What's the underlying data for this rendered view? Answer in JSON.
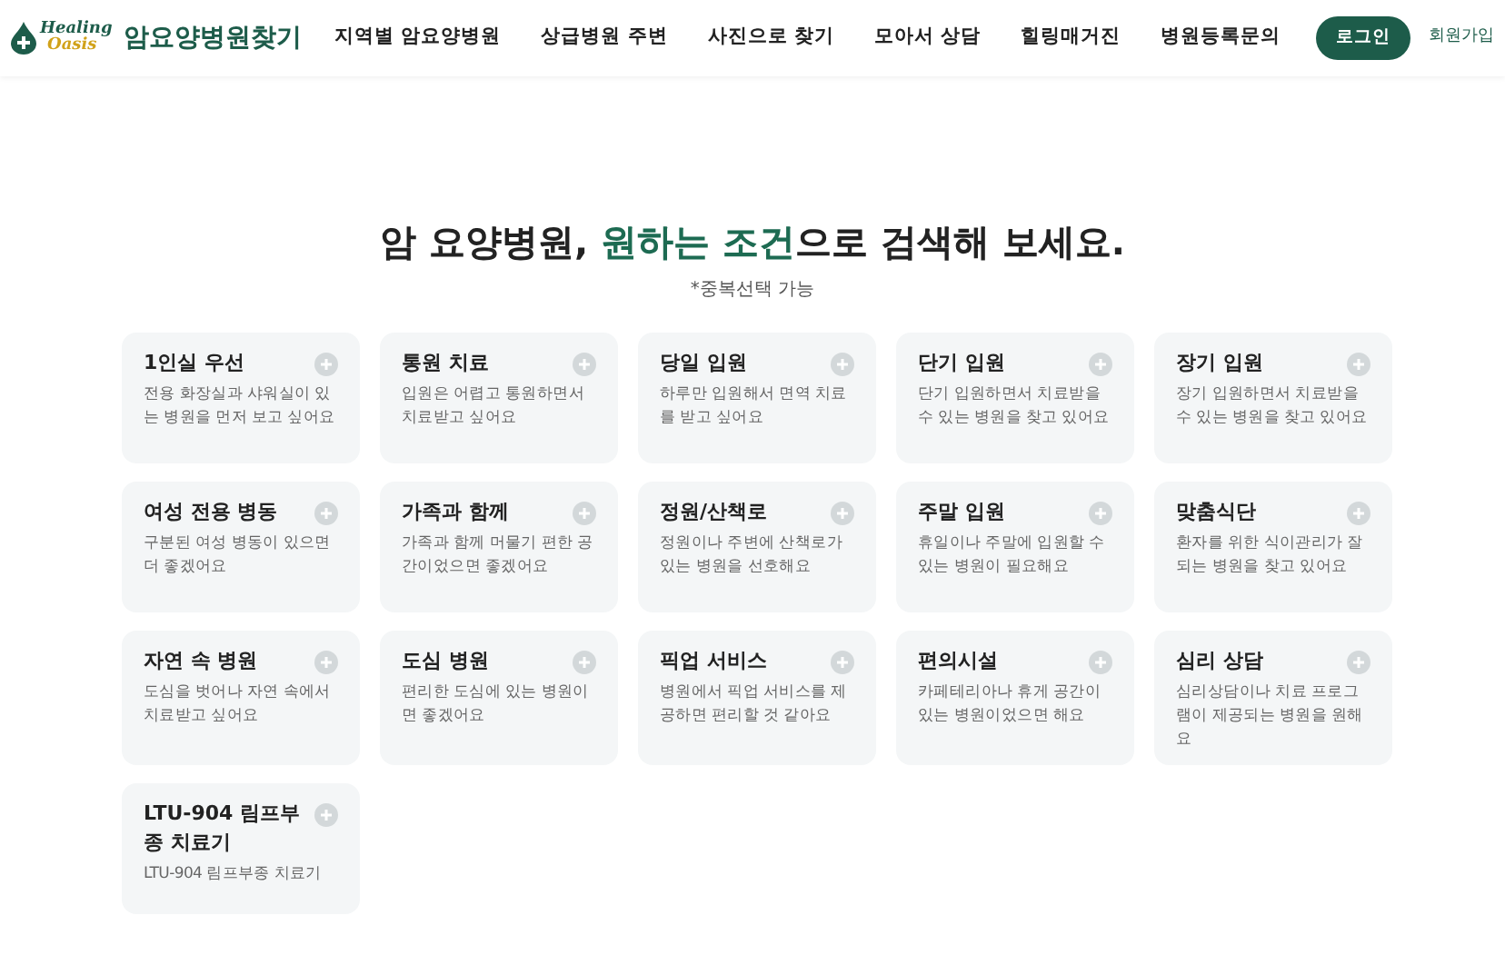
{
  "header": {
    "logo_script": [
      "Healing",
      "Oasis"
    ],
    "logo_title": "암요양병원찾기",
    "nav": [
      {
        "label": "지역별 암요양병원"
      },
      {
        "label": "상급병원 주변"
      },
      {
        "label": "사진으로 찾기"
      },
      {
        "label": "모아서 상담"
      },
      {
        "label": "힐링매거진"
      },
      {
        "label": "병원등록문의"
      }
    ],
    "login_button": "로그인",
    "signup_link": "회원가입"
  },
  "heading": [
    {
      "text": "암 요양병원, ",
      "highlight": false
    },
    {
      "text": "원하는 조건",
      "highlight": true
    },
    {
      "text": "으로 검색해 보세요.",
      "highlight": false
    }
  ],
  "subheading": "*중복선택 가능",
  "options": [
    {
      "title": "1인실 우선",
      "description": "전용 화장실과 샤워실이 있는 병원을 먼저 보고 싶어요",
      "selected": false
    },
    {
      "title": "통원 치료",
      "description": "입원은 어렵고 통원하면서 치료받고 싶어요",
      "selected": false
    },
    {
      "title": "당일 입원",
      "description": "하루만 입원해서 면역 치료를 받고 싶어요",
      "selected": false
    },
    {
      "title": "단기 입원",
      "description": "단기 입원하면서 치료받을 수 있는 병원을 찾고 있어요",
      "selected": false
    },
    {
      "title": "장기 입원",
      "description": "장기 입원하면서 치료받을 수 있는 병원을 찾고 있어요",
      "selected": false
    },
    {
      "title": "여성 전용 병동",
      "description": "구분된 여성 병동이 있으면 더 좋겠어요",
      "selected": false
    },
    {
      "title": "가족과 함께",
      "description": "가족과 함께 머물기 편한 공간이었으면 좋겠어요",
      "selected": false
    },
    {
      "title": "정원/산책로",
      "description": "정원이나 주변에 산책로가 있는 병원을 선호해요",
      "selected": false
    },
    {
      "title": "주말 입원",
      "description": "휴일이나 주말에 입원할 수 있는 병원이 필요해요",
      "selected": false
    },
    {
      "title": "맞춤식단",
      "description": "환자를 위한 식이관리가 잘 되는 병원을 찾고 있어요",
      "selected": false
    },
    {
      "title": "자연 속 병원",
      "description": "도심을 벗어나 자연 속에서 치료받고 싶어요",
      "selected": false
    },
    {
      "title": "도심 병원",
      "description": "편리한 도심에 있는 병원이면 좋겠어요",
      "selected": false
    },
    {
      "title": "픽업 서비스",
      "description": "병원에서 픽업 서비스를 제공하면 편리할 것 같아요",
      "selected": false
    },
    {
      "title": "편의시설",
      "description": "카페테리아나 휴게 공간이 있는 병원이었으면 해요",
      "selected": false
    },
    {
      "title": "심리 상담",
      "description": "심리상담이나 치료 프로그램이 제공되는 병원을 원해요",
      "selected": false
    },
    {
      "title": "LTU-904 림프부종 치료기",
      "description": "LTU-904 림프부종 치료기",
      "selected": false
    }
  ]
}
